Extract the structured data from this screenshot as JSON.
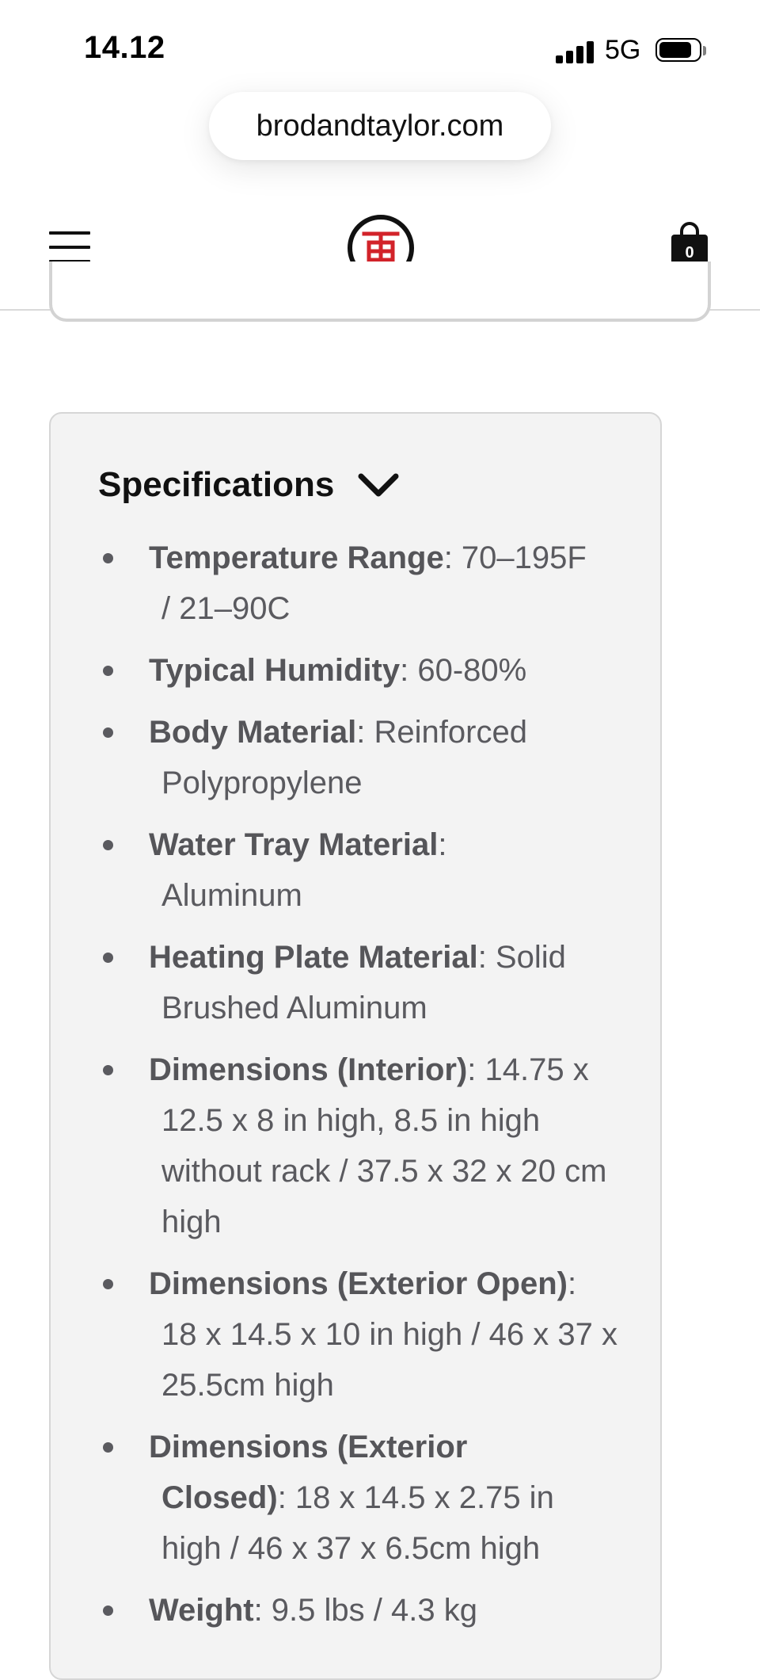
{
  "status_bar": {
    "time": "14.12",
    "network": "5G"
  },
  "browser": {
    "url": "brodandtaylor.com"
  },
  "header": {
    "cart_count": "0",
    "brand_color": "#d2232a"
  },
  "specifications": {
    "title": "Specifications",
    "items": [
      {
        "label": "Temperature Range",
        "value": ": 70–195F",
        "value2": "/ 21–90C"
      },
      {
        "label": "Typical Humidity",
        "value": ": 60-80%",
        "value2": ""
      },
      {
        "label": "Body Material",
        "value": ": Reinforced",
        "value2": "Polypropylene"
      },
      {
        "label": "Water Tray Material",
        "value": ":",
        "value2": "Aluminum"
      },
      {
        "label": "Heating Plate Material",
        "value": ": Solid",
        "value2": "Brushed Aluminum"
      },
      {
        "label": "Dimensions (Interior)",
        "value": ": 14.75 x",
        "value2": "12.5 x 8 in high, 8.5 in high without rack / 37.5 x 32 x 20 cm high"
      },
      {
        "label": "Dimensions (Exterior Open)",
        "value": ":",
        "value2": "18 x 14.5 x 10 in high / 46 x 37 x 25.5cm high"
      },
      {
        "label": "Dimensions (Exterior",
        "value": "",
        "value2": ""
      },
      {
        "label": "Weight",
        "value": ": 9.5 lbs / 4.3 kg",
        "value2": ""
      }
    ],
    "closed_label": "Closed)",
    "closed_value": ": 18 x 14.5 x 2.75 in high / 46 x 37 x 6.5cm high"
  }
}
